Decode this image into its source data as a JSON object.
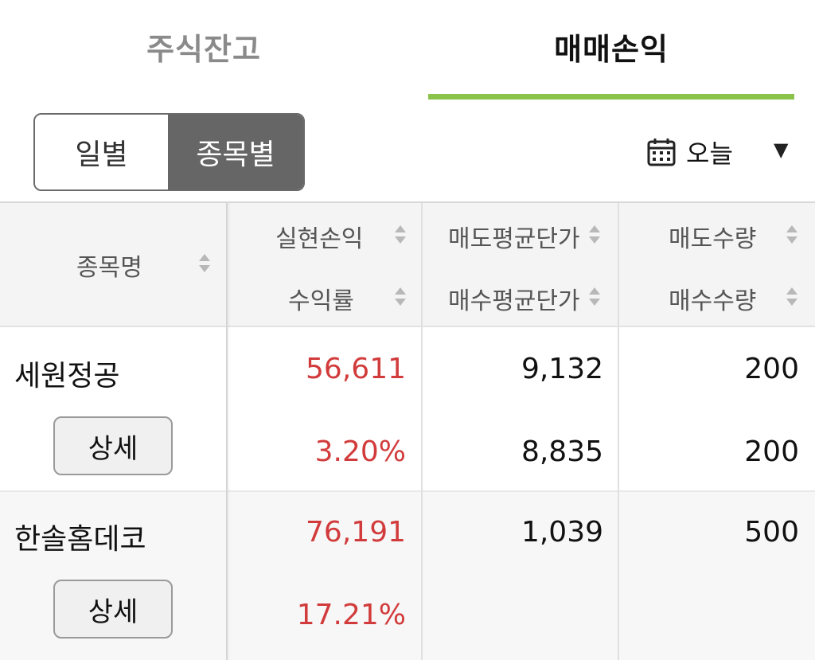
{
  "tabs": [
    {
      "label": "주식잔고",
      "active": false
    },
    {
      "label": "매매손익",
      "active": true
    }
  ],
  "accent_color": "#8bc34a",
  "toggle": {
    "daily": "일별",
    "by_stock": "종목별",
    "selected": "종목별"
  },
  "date_filter": {
    "icon": "calendar-icon",
    "value": "오늘"
  },
  "table": {
    "headers": {
      "name": "종목명",
      "realized_pl": "실현손익",
      "return_rate": "수익률",
      "avg_sell_price": "매도평균단가",
      "avg_buy_price": "매수평균단가",
      "sell_qty": "매도수량",
      "buy_qty": "매수수량"
    },
    "rows": [
      {
        "name": "세원정공",
        "detail": "상세",
        "realized_pl": "56,611",
        "return_rate": "3.20%",
        "avg_sell_price": "9,132",
        "avg_buy_price": "8,835",
        "sell_qty": "200",
        "buy_qty": "200"
      },
      {
        "name": "한솔홈데코",
        "detail": "상세",
        "realized_pl": "76,191",
        "return_rate": "17.21%",
        "avg_sell_price": "1,039",
        "avg_buy_price": "",
        "sell_qty": "500",
        "buy_qty": ""
      }
    ]
  },
  "profit_color": "#d23b3b"
}
